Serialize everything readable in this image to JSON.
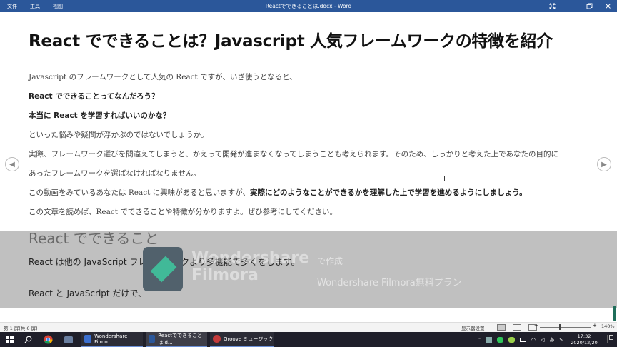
{
  "window": {
    "title": "Reactでできることは.docx - Word",
    "menu": [
      "文件",
      "工具",
      "视图"
    ]
  },
  "document": {
    "heading": "React でできることは？Javascript 人気フレームワークの特徴を紹介",
    "p1": "Javascript のフレームワークとして人気の React ですが、いざ使うとなると、",
    "p2": "React でできることってなんだろう？",
    "p3": "本当に React を学習すればいいのかな？",
    "p4": "といった悩みや疑問が浮かぶのではないでしょうか。",
    "p5": "実際、フレームワーク選びを間違えてしまうと、かえって開発が進まなくなってしまうことも考えられます。そのため、しっかりと考えた上であなたの目的に",
    "p6": "あったフレームワークを選ばなければなりません。",
    "p7a": "この動画をみているあなたは React に興味があると思いますが、",
    "p7b": "実際にどのようなことができるかを理解した上で学習を進めるようにしましょう。",
    "p8": "この文章を読めば、React でできることや特徴が分かりますよ。ぜひ参考にしてください。",
    "h2": "React でできること",
    "p9": "React は他の JavaScript フレームワークより多機能で多くをします。",
    "p10": "React と JavaScript だけで、"
  },
  "watermark": {
    "brand_line1": "Wondershare",
    "brand_line2": "Filmora",
    "made_with": "で作成",
    "plan": "Wondershare Filmora無料プラン"
  },
  "statusbar": {
    "page": "第 1 屏(共 6 屏)",
    "display_settings": "显示器设置",
    "zoom": "140%",
    "zoom_fraction": 0.4
  },
  "taskbar": {
    "apps": [
      {
        "label": "Wondershare Filmo...",
        "color": "#3b6fcf"
      },
      {
        "label": "Reactでできることは.d...",
        "color": "#2b579a"
      },
      {
        "label": "Groove ミュージック",
        "color": "#c43b3b"
      }
    ],
    "ime": "あ",
    "tray_s": "S",
    "time": "17:32",
    "date": "2020/12/20"
  }
}
